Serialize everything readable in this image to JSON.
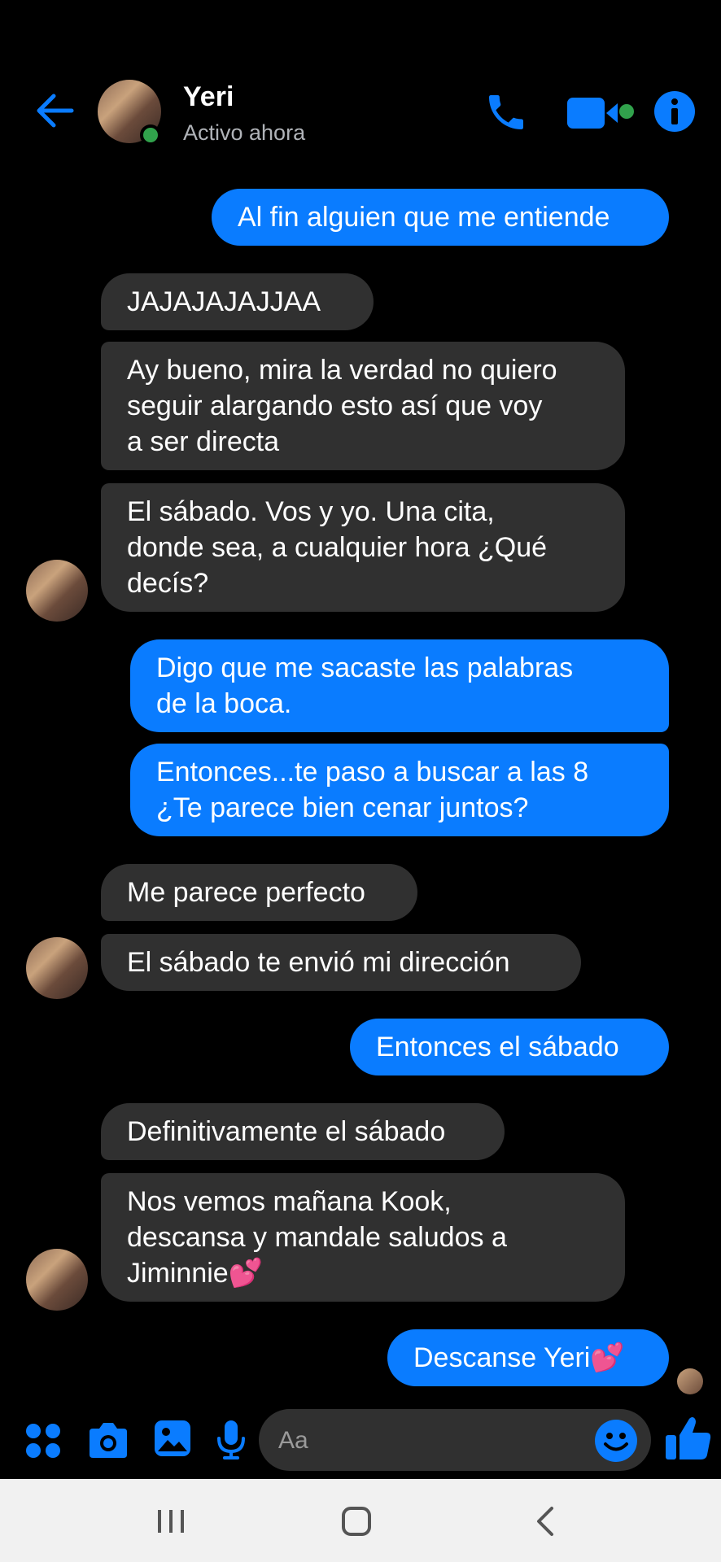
{
  "header": {
    "name": "Yeri",
    "status": "Activo ahora"
  },
  "messages": [
    {
      "from": "me",
      "text": "Al fin alguien que me entiende"
    },
    {
      "from": "them",
      "text": "JAJAJAJAJJAA"
    },
    {
      "from": "them",
      "text": "Ay bueno, mira la verdad no quiero\nseguir alargando esto así que voy\na ser directa"
    },
    {
      "from": "them",
      "text": "El sábado. Vos y yo. Una cita,\ndonde sea, a cualquier hora ¿Qué\ndecís?"
    },
    {
      "from": "me",
      "text": "Digo que me sacaste las palabras\nde la boca."
    },
    {
      "from": "me",
      "text": "Entonces...te paso a buscar a las 8\n¿Te parece bien cenar juntos?"
    },
    {
      "from": "them",
      "text": "Me parece perfecto"
    },
    {
      "from": "them",
      "text": "El sábado te envió mi dirección"
    },
    {
      "from": "me",
      "text": "Entonces el sábado"
    },
    {
      "from": "them",
      "text": "Definitivamente el sábado"
    },
    {
      "from": "them",
      "text": "Nos vemos mañana Kook,\ndescansa y mandale saludos a\nJiminnie💕"
    },
    {
      "from": "me",
      "text": "Descanse Yeri💕"
    }
  ],
  "composer": {
    "placeholder": "Aa"
  },
  "colors": {
    "accent": "#0a7cff",
    "incoming_bubble": "#303030",
    "online": "#31a24c"
  },
  "icons": [
    "back-arrow-icon",
    "phone-icon",
    "video-camera-icon",
    "info-icon",
    "apps-icon",
    "camera-icon",
    "image-icon",
    "microphone-icon",
    "emoji-icon",
    "thumbs-up-icon"
  ]
}
